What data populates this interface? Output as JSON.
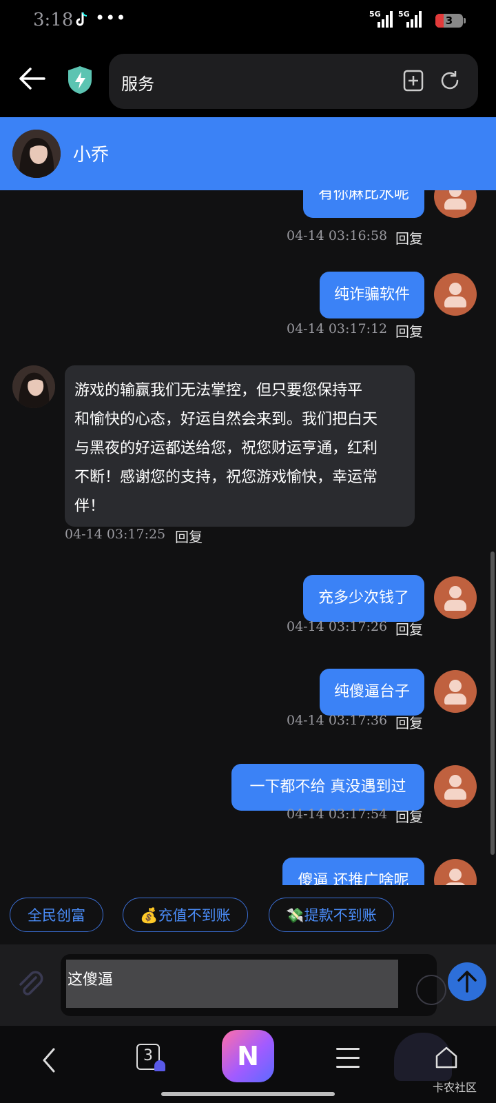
{
  "status": {
    "time": "3:18",
    "signal1": "5G",
    "signal2": "5G",
    "battery": "3"
  },
  "browser": {
    "url_text": "服务"
  },
  "chat": {
    "contact_name": "小乔"
  },
  "messages": [
    {
      "side": "right",
      "text": "有你麻比水呢",
      "time": "04-14 03:16:58",
      "reply": "回复"
    },
    {
      "side": "right",
      "text": "纯诈骗软件",
      "time": "04-14 03:17:12",
      "reply": "回复"
    },
    {
      "side": "left",
      "lines": [
        "游戏的输赢我们无法掌控，但只要您保持平",
        "和愉快的心态，好运自然会来到。我们把白天",
        "与黑夜的好运都送给您，祝您财运亨通，红利",
        "不断！感谢您的支持，祝您游戏愉快，幸运常",
        "伴！"
      ],
      "time": "04-14 03:17:25",
      "reply": "回复"
    },
    {
      "side": "right",
      "text": "充多少次钱了",
      "time": "04-14 03:17:26",
      "reply": "回复"
    },
    {
      "side": "right",
      "text": "纯傻逼台子",
      "time": "04-14 03:17:36",
      "reply": "回复"
    },
    {
      "side": "right",
      "text": "一下都不给 真没遇到过",
      "time": "04-14 03:17:54",
      "reply": "回复"
    },
    {
      "side": "right",
      "text": "傻逼 还推广啥呢"
    }
  ],
  "quick_tags": [
    "全民创富",
    "💰充值不到账",
    "💸提款不到账"
  ],
  "input": {
    "value": "这傻逼"
  },
  "nav": {
    "tabs_count": "3",
    "watermark": "卡农社区"
  }
}
